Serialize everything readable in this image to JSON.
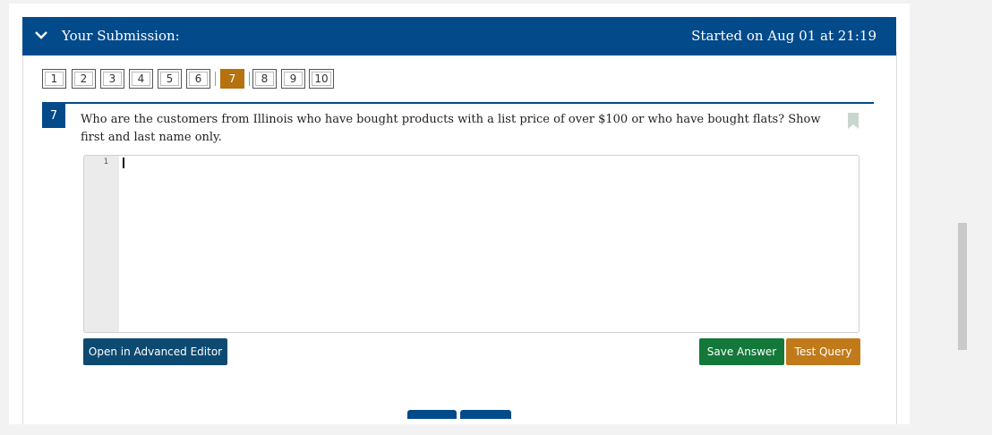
{
  "header": {
    "title": "Your Submission:",
    "started": "Started on Aug 01 at 21:19"
  },
  "question_nav": {
    "items": [
      "1",
      "2",
      "3",
      "4",
      "5",
      "6",
      "7",
      "8",
      "9",
      "10"
    ],
    "current": "7"
  },
  "question": {
    "number": "7",
    "text": "Who are the customers from Illinois who have bought products with a list price of over $100 or who have bought flats? Show first and last name only."
  },
  "editor": {
    "line_number": "1",
    "value": ""
  },
  "buttons": {
    "advanced_editor": "Open in Advanced Editor",
    "save_answer": "Save Answer",
    "test_query": "Test Query"
  },
  "colors": {
    "header": "#034a8a",
    "active_question": "#b5720f",
    "save": "#13783a",
    "test": "#c07a1a",
    "advanced": "#0d4a72"
  },
  "icons": {
    "header_toggle": "chevron-down-icon",
    "flag": "bookmark-icon"
  }
}
